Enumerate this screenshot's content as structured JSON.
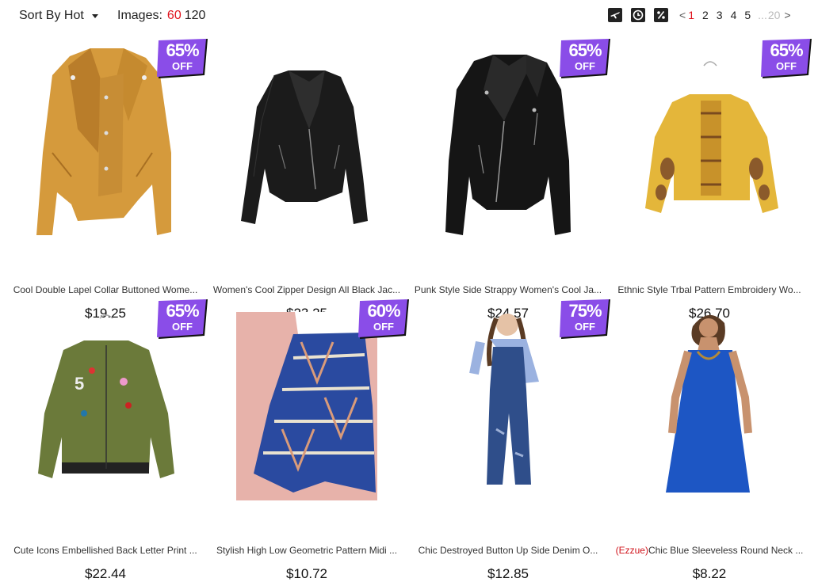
{
  "toolbar": {
    "sort_label": "Sort By Hot",
    "images_label": "Images:",
    "image_counts": [
      "60",
      "120"
    ],
    "icons": [
      "airplane-icon",
      "clock-icon",
      "percent-icon"
    ]
  },
  "pagination": {
    "prev": "<",
    "pages": [
      "1",
      "2",
      "3",
      "4",
      "5"
    ],
    "ellipsis": "...",
    "last": "20",
    "next": ">"
  },
  "colors": {
    "accent": "#e0141e",
    "badge": "#8a4de8"
  },
  "products": [
    {
      "title": "Cool Double Lapel Collar Buttoned Wome...",
      "brand": "",
      "price": "$19.25",
      "discount": "65%",
      "off": "OFF",
      "image": "mustard-leather-jacket"
    },
    {
      "title": "Women's Cool Zipper Design All Black Jac...",
      "brand": "",
      "price": "$23.25",
      "discount": "",
      "off": "",
      "image": "black-leather-jacket"
    },
    {
      "title": "Punk Style Side Strappy Women's Cool Ja...",
      "brand": "",
      "price": "$24.57",
      "discount": "65%",
      "off": "OFF",
      "image": "black-biker-jacket"
    },
    {
      "title": "Ethnic Style Trbal Pattern Embroidery Wo...",
      "brand": "",
      "price": "$26.70",
      "discount": "65%",
      "off": "OFF",
      "image": "yellow-embroidered-blouse"
    },
    {
      "title": "Cute Icons Embellished Back Letter Print ...",
      "brand": "",
      "price": "$22.44",
      "discount": "65%",
      "off": "OFF",
      "image": "green-bomber-jacket"
    },
    {
      "title": "Stylish High Low Geometric Pattern Midi ...",
      "brand": "",
      "price": "$10.72",
      "discount": "60%",
      "off": "OFF",
      "image": "geometric-midi-skirt"
    },
    {
      "title": "Chic Destroyed Button Up Side Denim O...",
      "brand": "",
      "price": "$12.85",
      "discount": "75%",
      "off": "OFF",
      "image": "denim-overalls"
    },
    {
      "title": "Chic Blue Sleeveless Round Neck ...",
      "brand": "(Ezzue)",
      "price": "$8.22",
      "discount": "",
      "off": "",
      "image": "blue-sleeveless-dress"
    }
  ]
}
